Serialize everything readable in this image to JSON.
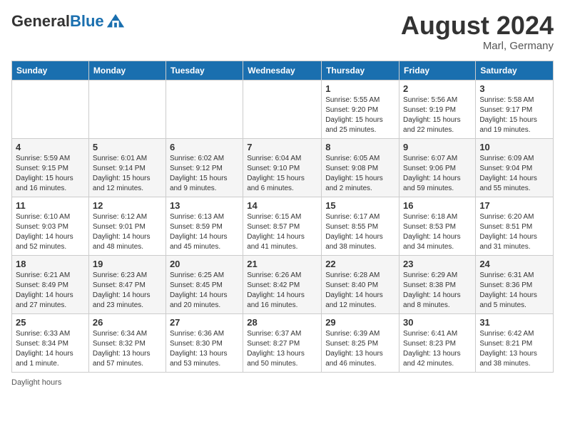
{
  "header": {
    "logo_general": "General",
    "logo_blue": "Blue",
    "month_year": "August 2024",
    "location": "Marl, Germany"
  },
  "days_of_week": [
    "Sunday",
    "Monday",
    "Tuesday",
    "Wednesday",
    "Thursday",
    "Friday",
    "Saturday"
  ],
  "footer_note": "Daylight hours",
  "weeks": [
    [
      {
        "day": "",
        "info": ""
      },
      {
        "day": "",
        "info": ""
      },
      {
        "day": "",
        "info": ""
      },
      {
        "day": "",
        "info": ""
      },
      {
        "day": "1",
        "info": "Sunrise: 5:55 AM\nSunset: 9:20 PM\nDaylight: 15 hours\nand 25 minutes."
      },
      {
        "day": "2",
        "info": "Sunrise: 5:56 AM\nSunset: 9:19 PM\nDaylight: 15 hours\nand 22 minutes."
      },
      {
        "day": "3",
        "info": "Sunrise: 5:58 AM\nSunset: 9:17 PM\nDaylight: 15 hours\nand 19 minutes."
      }
    ],
    [
      {
        "day": "4",
        "info": "Sunrise: 5:59 AM\nSunset: 9:15 PM\nDaylight: 15 hours\nand 16 minutes."
      },
      {
        "day": "5",
        "info": "Sunrise: 6:01 AM\nSunset: 9:14 PM\nDaylight: 15 hours\nand 12 minutes."
      },
      {
        "day": "6",
        "info": "Sunrise: 6:02 AM\nSunset: 9:12 PM\nDaylight: 15 hours\nand 9 minutes."
      },
      {
        "day": "7",
        "info": "Sunrise: 6:04 AM\nSunset: 9:10 PM\nDaylight: 15 hours\nand 6 minutes."
      },
      {
        "day": "8",
        "info": "Sunrise: 6:05 AM\nSunset: 9:08 PM\nDaylight: 15 hours\nand 2 minutes."
      },
      {
        "day": "9",
        "info": "Sunrise: 6:07 AM\nSunset: 9:06 PM\nDaylight: 14 hours\nand 59 minutes."
      },
      {
        "day": "10",
        "info": "Sunrise: 6:09 AM\nSunset: 9:04 PM\nDaylight: 14 hours\nand 55 minutes."
      }
    ],
    [
      {
        "day": "11",
        "info": "Sunrise: 6:10 AM\nSunset: 9:03 PM\nDaylight: 14 hours\nand 52 minutes."
      },
      {
        "day": "12",
        "info": "Sunrise: 6:12 AM\nSunset: 9:01 PM\nDaylight: 14 hours\nand 48 minutes."
      },
      {
        "day": "13",
        "info": "Sunrise: 6:13 AM\nSunset: 8:59 PM\nDaylight: 14 hours\nand 45 minutes."
      },
      {
        "day": "14",
        "info": "Sunrise: 6:15 AM\nSunset: 8:57 PM\nDaylight: 14 hours\nand 41 minutes."
      },
      {
        "day": "15",
        "info": "Sunrise: 6:17 AM\nSunset: 8:55 PM\nDaylight: 14 hours\nand 38 minutes."
      },
      {
        "day": "16",
        "info": "Sunrise: 6:18 AM\nSunset: 8:53 PM\nDaylight: 14 hours\nand 34 minutes."
      },
      {
        "day": "17",
        "info": "Sunrise: 6:20 AM\nSunset: 8:51 PM\nDaylight: 14 hours\nand 31 minutes."
      }
    ],
    [
      {
        "day": "18",
        "info": "Sunrise: 6:21 AM\nSunset: 8:49 PM\nDaylight: 14 hours\nand 27 minutes."
      },
      {
        "day": "19",
        "info": "Sunrise: 6:23 AM\nSunset: 8:47 PM\nDaylight: 14 hours\nand 23 minutes."
      },
      {
        "day": "20",
        "info": "Sunrise: 6:25 AM\nSunset: 8:45 PM\nDaylight: 14 hours\nand 20 minutes."
      },
      {
        "day": "21",
        "info": "Sunrise: 6:26 AM\nSunset: 8:42 PM\nDaylight: 14 hours\nand 16 minutes."
      },
      {
        "day": "22",
        "info": "Sunrise: 6:28 AM\nSunset: 8:40 PM\nDaylight: 14 hours\nand 12 minutes."
      },
      {
        "day": "23",
        "info": "Sunrise: 6:29 AM\nSunset: 8:38 PM\nDaylight: 14 hours\nand 8 minutes."
      },
      {
        "day": "24",
        "info": "Sunrise: 6:31 AM\nSunset: 8:36 PM\nDaylight: 14 hours\nand 5 minutes."
      }
    ],
    [
      {
        "day": "25",
        "info": "Sunrise: 6:33 AM\nSunset: 8:34 PM\nDaylight: 14 hours\nand 1 minute."
      },
      {
        "day": "26",
        "info": "Sunrise: 6:34 AM\nSunset: 8:32 PM\nDaylight: 13 hours\nand 57 minutes."
      },
      {
        "day": "27",
        "info": "Sunrise: 6:36 AM\nSunset: 8:30 PM\nDaylight: 13 hours\nand 53 minutes."
      },
      {
        "day": "28",
        "info": "Sunrise: 6:37 AM\nSunset: 8:27 PM\nDaylight: 13 hours\nand 50 minutes."
      },
      {
        "day": "29",
        "info": "Sunrise: 6:39 AM\nSunset: 8:25 PM\nDaylight: 13 hours\nand 46 minutes."
      },
      {
        "day": "30",
        "info": "Sunrise: 6:41 AM\nSunset: 8:23 PM\nDaylight: 13 hours\nand 42 minutes."
      },
      {
        "day": "31",
        "info": "Sunrise: 6:42 AM\nSunset: 8:21 PM\nDaylight: 13 hours\nand 38 minutes."
      }
    ]
  ]
}
